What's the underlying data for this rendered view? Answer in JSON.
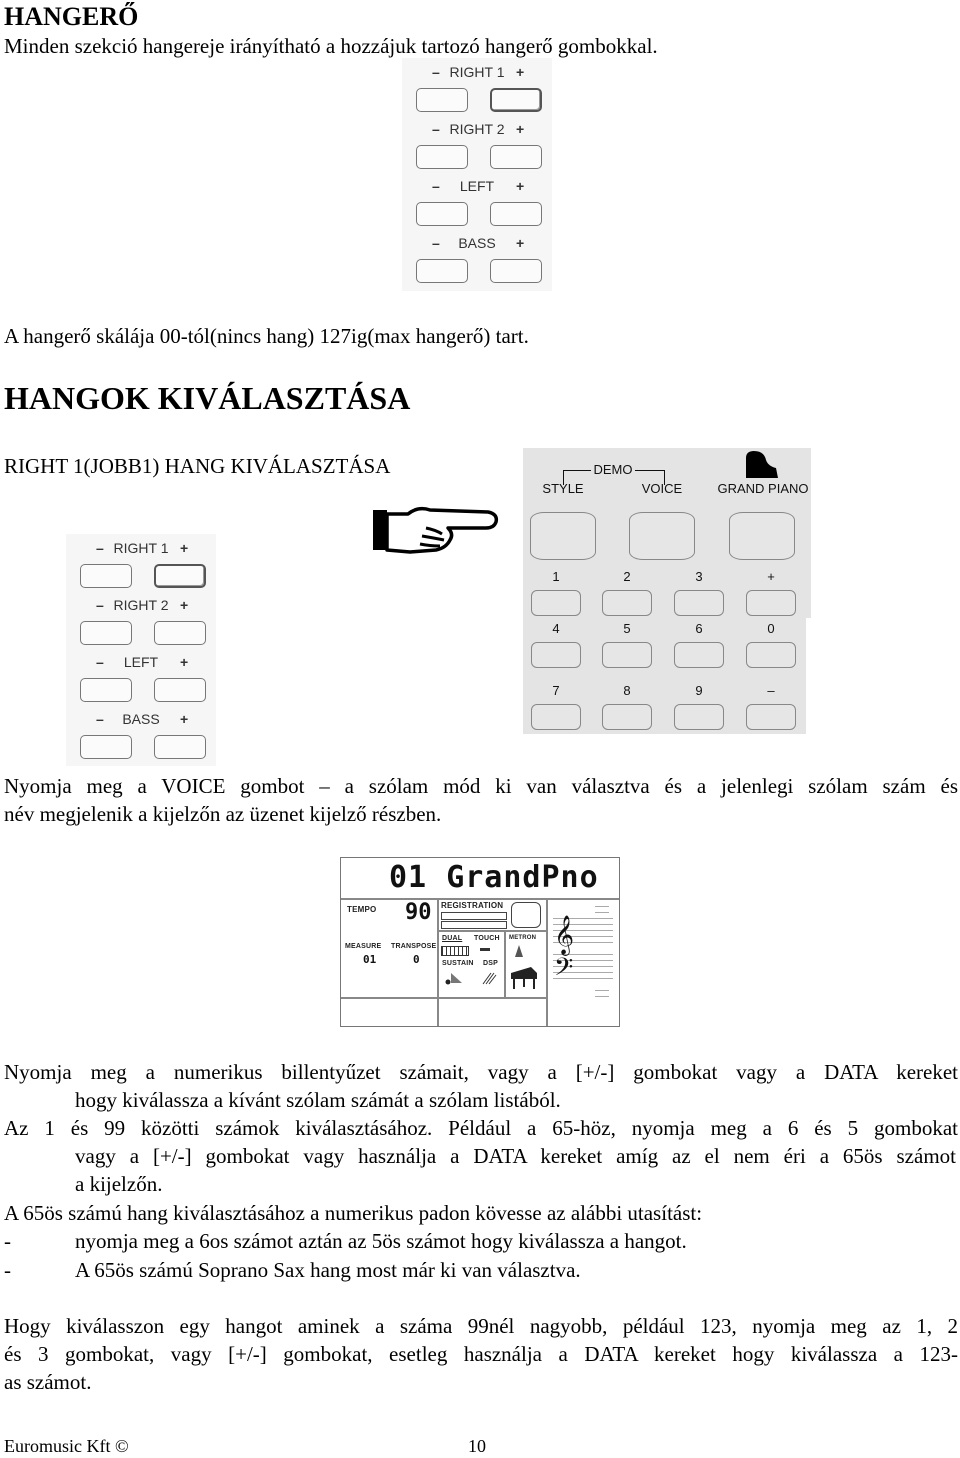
{
  "sections": {
    "volume": {
      "heading": "HANGERŐ",
      "intro": "Minden szekció hangereje irányítható a hozzájuk tartozó hangerő gombokkal.",
      "range_text": "A hangerő skálája 00-tól(nincs hang) 127ig(max hangerő) tart."
    },
    "voice_select": {
      "heading": "HANGOK KIVÁLASZTÁSA",
      "subheading": "RIGHT 1(JOBB1) HANG KIVÁLASZTÁSA",
      "voice_press_line1": "Nyomja meg a VOICE gombot – a szólam mód ki van választva és a jelenlegi szólam szám és",
      "voice_press_line2": "név megjelenik a kijelzőn az üzenet kijelző részben."
    },
    "instructions": {
      "p1_line1": "Nyomja meg a numerikus billentyűzet számait, vagy a [+/-] gombokat vagy a DATA kereket",
      "p1_line2": "hogy kiválassza a kívánt szólam számát a szólam listából.",
      "p2_line1": "Az 1 és 99 közötti számok kiválasztásához. Például a 65-höz, nyomja meg a 6 és 5 gombokat",
      "p2_line2": "vagy a [+/-] gombokat vagy használja a DATA kereket amíg az el nem éri a 65ös számot",
      "p2_line3": "a kijelzőn.",
      "p3": "A 65ös számú hang kiválasztásához a numerikus padon kövesse az alábbi utasítást:",
      "bullets": [
        {
          "marker": "-",
          "text": "nyomja meg a 6os számot aztán az 5ös számot hogy kiválassza a hangot."
        },
        {
          "marker": "-",
          "text": "A 65ös számú Soprano Sax hang most már ki van választva."
        }
      ],
      "p4_line1": "Hogy kiválasszon egy hangot aminek a száma 99nél nagyobb, például 123, nyomja meg az 1, 2",
      "p4_line2": "és 3 gombokat, vagy [+/-] gombokat, esetleg használja a DATA kereket hogy kiválassza a 123-",
      "p4_line3": "as számot."
    }
  },
  "volume_panel": {
    "rows": [
      {
        "name": "RIGHT 1",
        "minus": "–",
        "plus": "+",
        "active": "plus"
      },
      {
        "name": "RIGHT 2",
        "minus": "–",
        "plus": "+",
        "active": ""
      },
      {
        "name": "LEFT",
        "minus": "–",
        "plus": "+",
        "active": ""
      },
      {
        "name": "BASS",
        "minus": "–",
        "plus": "+",
        "active": ""
      }
    ]
  },
  "keypad": {
    "demo_label": "DEMO",
    "top_buttons": [
      "STYLE",
      "VOICE",
      "GRAND PIANO"
    ],
    "keys": [
      [
        "1",
        "2",
        "3",
        "+"
      ],
      [
        "4",
        "5",
        "6",
        "0"
      ],
      [
        "7",
        "8",
        "9",
        "–"
      ]
    ]
  },
  "pointer_icon": "pointing-hand-icon",
  "lcd": {
    "voice_number": "01",
    "voice_name": "GrandPno",
    "tempo_label": "TEMPO",
    "tempo_value": "90",
    "registration_label": "REGISTRATION",
    "measure_label": "MEASURE",
    "measure_value": "01",
    "transpose_label": "TRANSPOSE",
    "transpose_value": "0",
    "dual_label": "DUAL",
    "touch_label": "TOUCH",
    "metron_label": "METRON",
    "sustain_label": "SUSTAIN",
    "dsp_label": "DSP"
  },
  "footer": {
    "company": "Euromusic Kft ©",
    "page_number": "10"
  }
}
